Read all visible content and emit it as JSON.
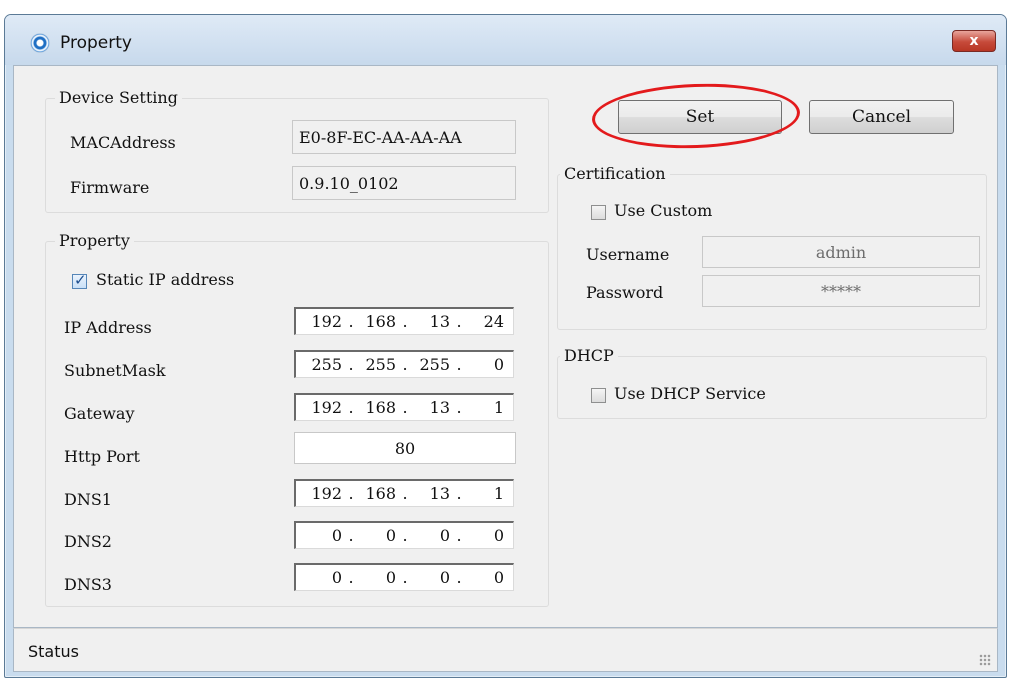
{
  "window": {
    "title": "Property",
    "close_glyph": "x"
  },
  "device_setting": {
    "label": "Device Setting",
    "mac_label": "MACAddress",
    "mac_value": "E0-8F-EC-AA-AA-AA",
    "firmware_label": "Firmware",
    "firmware_value": "0.9.10_0102"
  },
  "property": {
    "label": "Property",
    "static_ip": {
      "label": "Static IP address",
      "checked": true
    },
    "ip_label": "IP Address",
    "ip": [
      "192",
      "168",
      "13",
      "24"
    ],
    "subnet_label": "SubnetMask",
    "subnet": [
      "255",
      "255",
      "255",
      "0"
    ],
    "gateway_label": "Gateway",
    "gateway": [
      "192",
      "168",
      "13",
      "1"
    ],
    "http_port_label": "Http Port",
    "http_port": "80",
    "dns1_label": "DNS1",
    "dns1": [
      "192",
      "168",
      "13",
      "1"
    ],
    "dns2_label": "DNS2",
    "dns2": [
      "0",
      "0",
      "0",
      "0"
    ],
    "dns3_label": "DNS3",
    "dns3": [
      "0",
      "0",
      "0",
      "0"
    ]
  },
  "buttons": {
    "set": "Set",
    "cancel": "Cancel"
  },
  "certification": {
    "label": "Certification",
    "use_custom": {
      "label": "Use Custom",
      "checked": false
    },
    "username_label": "Username",
    "username": "admin",
    "password_label": "Password",
    "password": "*****"
  },
  "dhcp": {
    "label": "DHCP",
    "use_dhcp": {
      "label": "Use DHCP Service",
      "checked": false
    }
  },
  "status": {
    "text": "Status"
  },
  "icons": [
    "app-icon",
    "close-icon",
    "size-grip-icon"
  ],
  "colors": {
    "highlight_ring": "#e31a1c",
    "title_bar": "#c9dcee",
    "close_button": "#c64a3a"
  }
}
